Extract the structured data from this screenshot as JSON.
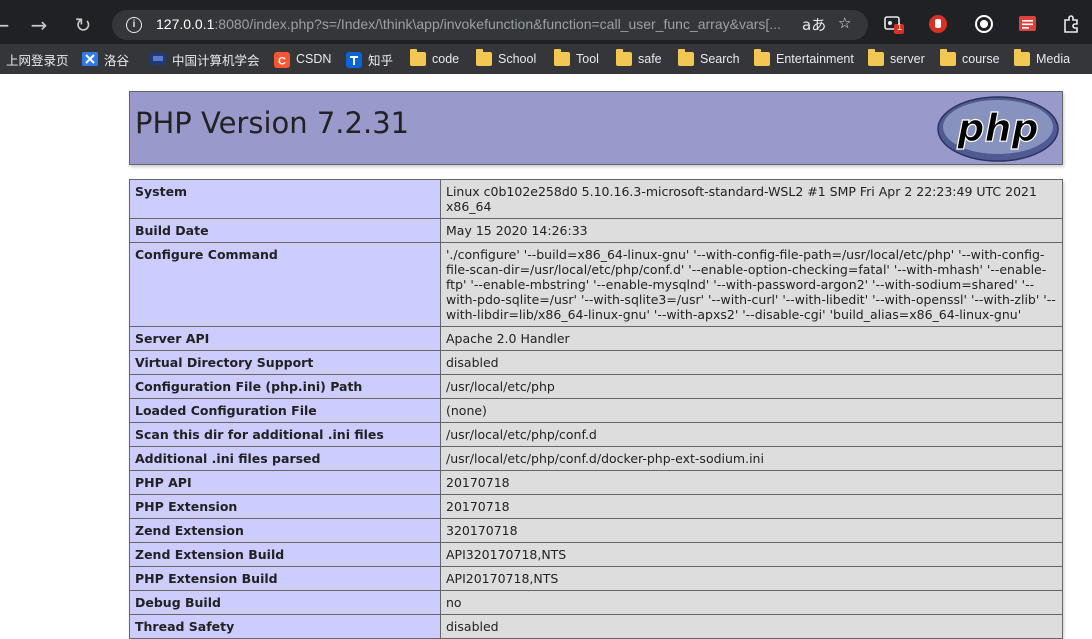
{
  "browser": {
    "url_host": "127.0.0.1",
    "url_rest": ":8080/index.php?s=/Index/\\think\\app/invokefunction&function=call_user_func_array&vars[...",
    "extension_badge": "1",
    "bookmarks": [
      {
        "label": "上网登录页",
        "icon": "none"
      },
      {
        "label": "洛谷",
        "icon": "luogu-icon"
      },
      {
        "label": "中国计算机学会",
        "icon": "ccf-icon"
      },
      {
        "label": "CSDN",
        "icon": "csdn-icon"
      },
      {
        "label": "知乎",
        "icon": "zhihu-icon"
      },
      {
        "label": "code",
        "icon": "folder-icon"
      },
      {
        "label": "School",
        "icon": "folder-icon"
      },
      {
        "label": "Tool",
        "icon": "folder-icon"
      },
      {
        "label": "safe",
        "icon": "folder-icon"
      },
      {
        "label": "Search",
        "icon": "folder-icon"
      },
      {
        "label": "Entertainment",
        "icon": "folder-icon"
      },
      {
        "label": "server",
        "icon": "folder-icon"
      },
      {
        "label": "course",
        "icon": "folder-icon"
      },
      {
        "label": "Media",
        "icon": "folder-icon"
      }
    ]
  },
  "php": {
    "title": "PHP Version 7.2.31",
    "logo_text": "php",
    "rows": [
      {
        "key": "System",
        "value": "Linux c0b102e258d0 5.10.16.3-microsoft-standard-WSL2 #1 SMP Fri Apr 2 22:23:49 UTC 2021 x86_64"
      },
      {
        "key": "Build Date",
        "value": "May 15 2020 14:26:33"
      },
      {
        "key": "Configure Command",
        "value": "'./configure' '--build=x86_64-linux-gnu' '--with-config-file-path=/usr/local/etc/php' '--with-config-file-scan-dir=/usr/local/etc/php/conf.d' '--enable-option-checking=fatal' '--with-mhash' '--enable-ftp' '--enable-mbstring' '--enable-mysqlnd' '--with-password-argon2' '--with-sodium=shared' '--with-pdo-sqlite=/usr' '--with-sqlite3=/usr' '--with-curl' '--with-libedit' '--with-openssl' '--with-zlib' '--with-libdir=lib/x86_64-linux-gnu' '--with-apxs2' '--disable-cgi' 'build_alias=x86_64-linux-gnu'"
      },
      {
        "key": "Server API",
        "value": "Apache 2.0 Handler"
      },
      {
        "key": "Virtual Directory Support",
        "value": "disabled"
      },
      {
        "key": "Configuration File (php.ini) Path",
        "value": "/usr/local/etc/php"
      },
      {
        "key": "Loaded Configuration File",
        "value": "(none)"
      },
      {
        "key": "Scan this dir for additional .ini files",
        "value": "/usr/local/etc/php/conf.d"
      },
      {
        "key": "Additional .ini files parsed",
        "value": "/usr/local/etc/php/conf.d/docker-php-ext-sodium.ini"
      },
      {
        "key": "PHP API",
        "value": "20170718"
      },
      {
        "key": "PHP Extension",
        "value": "20170718"
      },
      {
        "key": "Zend Extension",
        "value": "320170718"
      },
      {
        "key": "Zend Extension Build",
        "value": "API320170718,NTS"
      },
      {
        "key": "PHP Extension Build",
        "value": "API20170718,NTS"
      },
      {
        "key": "Debug Build",
        "value": "no"
      },
      {
        "key": "Thread Safety",
        "value": "disabled"
      }
    ]
  },
  "colors": {
    "header_bg": "#9999cc",
    "key_cell_bg": "#ccccff",
    "value_cell_bg": "#dddddd",
    "chrome_bg": "#202124",
    "bookmark_bar_bg": "#35363a"
  }
}
